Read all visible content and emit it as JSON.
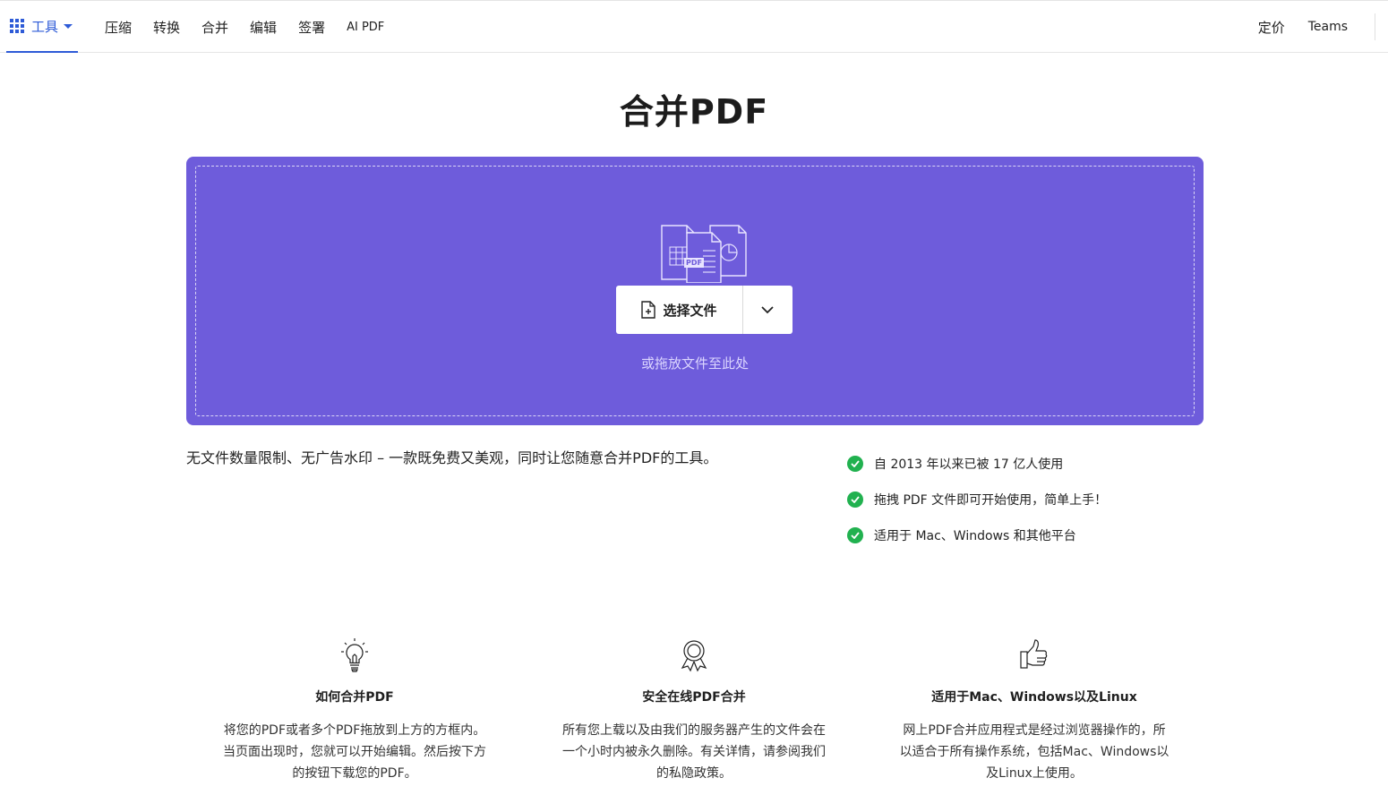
{
  "nav": {
    "tools_label": "工具",
    "links": [
      "压缩",
      "转换",
      "合并",
      "编辑",
      "签署",
      "AI PDF"
    ],
    "right_links": [
      "定价",
      "Teams"
    ]
  },
  "page": {
    "title": "合并PDF"
  },
  "dropzone": {
    "select_label": "选择文件",
    "drop_hint": "或拖放文件至此处",
    "illustration_badge": "PDF"
  },
  "description": "无文件数量限制、无广告水印 – 一款既免费又美观，同时让您随意合并PDF的工具。",
  "features": [
    "自 2013 年以来已被 17 亿人使用",
    "拖拽 PDF 文件即可开始使用，简单上手！",
    "适用于 Mac、Windows 和其他平台"
  ],
  "info": [
    {
      "icon": "lightbulb-icon",
      "title": "如何合并PDF",
      "text": "将您的PDF或者多个PDF拖放到上方的方框内。当页面出现时，您就可以开始编辑。然后按下方的按钮下载您的PDF。"
    },
    {
      "icon": "award-ribbon-icon",
      "title": "安全在线PDF合并",
      "text": "所有您上载以及由我们的服务器产生的文件会在一个小时内被永久删除。有关详情，请参阅我们的私隐政策。"
    },
    {
      "icon": "thumbs-up-icon",
      "title": "适用于Mac、Windows以及Linux",
      "text": "网上PDF合并应用程式是经过浏览器操作的，所以适合于所有操作系统，包括Mac、Windows以及Linux上使用。"
    }
  ],
  "colors": {
    "accent": "#2e5bd7",
    "dropzone": "#6e5cdb",
    "check": "#21b14f"
  }
}
